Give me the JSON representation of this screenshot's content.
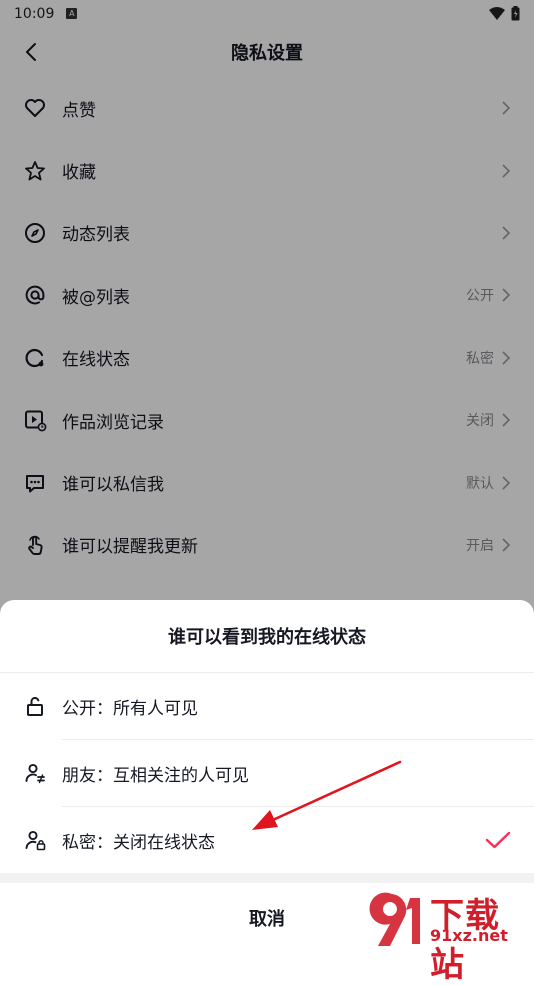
{
  "status_bar": {
    "time": "10:09",
    "badge": "A"
  },
  "nav": {
    "title": "隐私设置"
  },
  "settings": [
    {
      "icon": "heart-icon",
      "label": "点赞",
      "value": ""
    },
    {
      "icon": "star-icon",
      "label": "收藏",
      "value": ""
    },
    {
      "icon": "compass-icon",
      "label": "动态列表",
      "value": ""
    },
    {
      "icon": "at-icon",
      "label": "被@列表",
      "value": "公开"
    },
    {
      "icon": "online-icon",
      "label": "在线状态",
      "value": "私密"
    },
    {
      "icon": "video-history-icon",
      "label": "作品浏览记录",
      "value": "关闭"
    },
    {
      "icon": "message-icon",
      "label": "谁可以私信我",
      "value": "默认"
    },
    {
      "icon": "tap-icon",
      "label": "谁可以提醒我更新",
      "value": "开启"
    }
  ],
  "sheet": {
    "title": "谁可以看到我的在线状态",
    "options": [
      {
        "icon": "unlock-icon",
        "label": "公开：所有人可见",
        "selected": false
      },
      {
        "icon": "friends-icon",
        "label": "朋友：互相关注的人可见",
        "selected": false
      },
      {
        "icon": "private-user-icon",
        "label": "私密：关闭在线状态",
        "selected": true
      }
    ],
    "cancel": "取消"
  },
  "colors": {
    "accent": "#fe2c55",
    "arrow": "#e0161f",
    "overlay": "rgba(0,0,0,0.35)"
  },
  "watermark": {
    "cn": "下载站",
    "en": "91xz.net"
  }
}
